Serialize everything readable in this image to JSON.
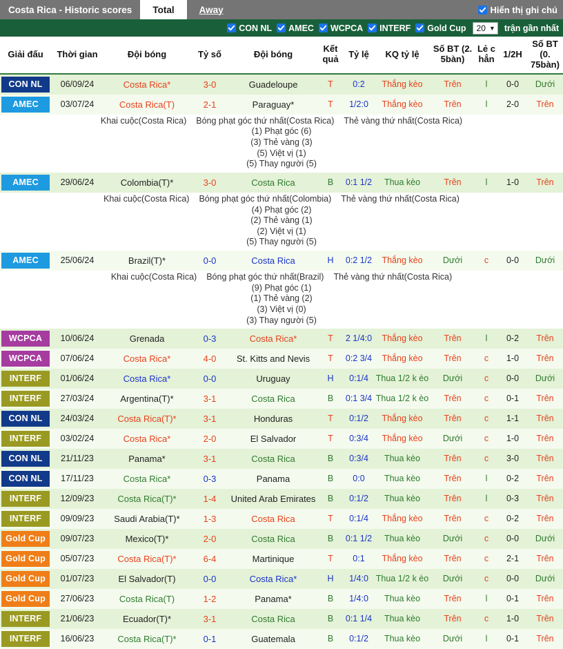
{
  "header": {
    "title": "Costa Rica - Historic scores",
    "tabs": [
      {
        "label": "Total",
        "active": true
      },
      {
        "label": "Away",
        "active": false
      }
    ],
    "show_notes_label": "Hiển thị ghi chú",
    "show_notes_checked": true
  },
  "filters": {
    "leagues": [
      {
        "label": "CON NL",
        "checked": true
      },
      {
        "label": "AMEC",
        "checked": true
      },
      {
        "label": "WCPCA",
        "checked": true
      },
      {
        "label": "INTERF",
        "checked": true
      },
      {
        "label": "Gold Cup",
        "checked": true
      }
    ],
    "count_value": "20",
    "count_suffix": "trận gần nhất"
  },
  "columns": [
    "Giải đấu",
    "Thời gian",
    "Đội bóng",
    "Tỷ số",
    "Đội bóng",
    "Kết quả",
    "Tỷ lệ",
    "KQ tỷ lệ",
    "Số BT (2. 5bàn)",
    "Lẻ c hẳn",
    "1/2H",
    "Số BT (0. 75bàn)"
  ],
  "league_colors": {
    "CON NL": "#123a8a",
    "AMEC": "#1e9ae0",
    "WCPCA": "#a63ba0",
    "INTERF": "#9a9a22",
    "Gold Cup": "#f07e18"
  },
  "rows": [
    {
      "league": "CON NL",
      "date": "06/09/24",
      "home": "Costa Rica*",
      "home_color": "red",
      "score": "3-0",
      "score_color": "red",
      "away": "Guadeloupe",
      "away_color": "dark",
      "result": "T",
      "result_color": "red",
      "odds": "0:2",
      "odds_color": "blue",
      "odds_result": "Thắng kèo",
      "odds_result_color": "red",
      "ou25": "Trên",
      "ou25_color": "red",
      "oddeven": "l",
      "oddeven_color": "green",
      "half": "0-0",
      "half_color": "dark",
      "ou075": "Dưới",
      "ou075_color": "green"
    },
    {
      "league": "AMEC",
      "date": "03/07/24",
      "home": "Costa Rica(T)",
      "home_color": "red",
      "score": "2-1",
      "score_color": "red",
      "away": "Paraguay*",
      "away_color": "dark",
      "result": "T",
      "result_color": "red",
      "odds": "1/2:0",
      "odds_color": "blue",
      "odds_result": "Thắng kèo",
      "odds_result_color": "red",
      "ou25": "Trên",
      "ou25_color": "red",
      "oddeven": "l",
      "oddeven_color": "green",
      "half": "2-0",
      "half_color": "dark",
      "ou075": "Trên",
      "ou075_color": "red",
      "note": {
        "head": [
          "Khai cuộc(Costa Rica)",
          "Bóng phạt góc thứ nhất(Costa Rica)",
          "Thẻ vàng thứ nhất(Costa Rica)"
        ],
        "lines": [
          "(1) Phạt góc (6)",
          "(3) Thẻ vàng (3)",
          "(5) Việt vị (1)",
          "(5) Thay người (5)"
        ]
      }
    },
    {
      "league": "AMEC",
      "date": "29/06/24",
      "home": "Colombia(T)*",
      "home_color": "dark",
      "score": "3-0",
      "score_color": "red",
      "away": "Costa Rica",
      "away_color": "green",
      "result": "B",
      "result_color": "green",
      "odds": "0:1 1/2",
      "odds_color": "blue",
      "odds_result": "Thua kèo",
      "odds_result_color": "green",
      "ou25": "Trên",
      "ou25_color": "red",
      "oddeven": "l",
      "oddeven_color": "green",
      "half": "1-0",
      "half_color": "dark",
      "ou075": "Trên",
      "ou075_color": "red",
      "note": {
        "head": [
          "Khai cuộc(Costa Rica)",
          "Bóng phạt góc thứ nhất(Colombia)",
          "Thẻ vàng thứ nhất(Costa Rica)"
        ],
        "lines": [
          "(4) Phạt góc (2)",
          "(2) Thẻ vàng (1)",
          "(2) Việt vị (1)",
          "(5) Thay người (5)"
        ]
      }
    },
    {
      "league": "AMEC",
      "date": "25/06/24",
      "home": "Brazil(T)*",
      "home_color": "dark",
      "score": "0-0",
      "score_color": "blue",
      "away": "Costa Rica",
      "away_color": "blue",
      "result": "H",
      "result_color": "blue",
      "odds": "0:2 1/2",
      "odds_color": "blue",
      "odds_result": "Thắng kèo",
      "odds_result_color": "red",
      "ou25": "Dưới",
      "ou25_color": "green",
      "oddeven": "c",
      "oddeven_color": "red",
      "half": "0-0",
      "half_color": "dark",
      "ou075": "Dưới",
      "ou075_color": "green",
      "note": {
        "head": [
          "Khai cuộc(Costa Rica)",
          "Bóng phạt góc thứ nhất(Brazil)",
          "Thẻ vàng thứ nhất(Costa Rica)"
        ],
        "lines": [
          "(9) Phạt góc (1)",
          "(1) Thẻ vàng (2)",
          "(3) Việt vị (0)",
          "(3) Thay người (5)"
        ]
      }
    },
    {
      "league": "WCPCA",
      "date": "10/06/24",
      "home": "Grenada",
      "home_color": "dark",
      "score": "0-3",
      "score_color": "blue",
      "away": "Costa Rica*",
      "away_color": "red",
      "result": "T",
      "result_color": "red",
      "odds": "2 1/4:0",
      "odds_color": "blue",
      "odds_result": "Thắng kèo",
      "odds_result_color": "red",
      "ou25": "Trên",
      "ou25_color": "red",
      "oddeven": "l",
      "oddeven_color": "green",
      "half": "0-2",
      "half_color": "dark",
      "ou075": "Trên",
      "ou075_color": "red"
    },
    {
      "league": "WCPCA",
      "date": "07/06/24",
      "home": "Costa Rica*",
      "home_color": "red",
      "score": "4-0",
      "score_color": "red",
      "away": "St. Kitts and Nevis",
      "away_color": "dark",
      "result": "T",
      "result_color": "red",
      "odds": "0:2 3/4",
      "odds_color": "blue",
      "odds_result": "Thắng kèo",
      "odds_result_color": "red",
      "ou25": "Trên",
      "ou25_color": "red",
      "oddeven": "c",
      "oddeven_color": "red",
      "half": "1-0",
      "half_color": "dark",
      "ou075": "Trên",
      "ou075_color": "red"
    },
    {
      "league": "INTERF",
      "date": "01/06/24",
      "home": "Costa Rica*",
      "home_color": "blue",
      "score": "0-0",
      "score_color": "blue",
      "away": "Uruguay",
      "away_color": "dark",
      "result": "H",
      "result_color": "blue",
      "odds": "0:1/4",
      "odds_color": "blue",
      "odds_result": "Thua 1/2 k èo",
      "odds_result_color": "green",
      "ou25": "Dưới",
      "ou25_color": "green",
      "oddeven": "c",
      "oddeven_color": "red",
      "half": "0-0",
      "half_color": "dark",
      "ou075": "Dưới",
      "ou075_color": "green"
    },
    {
      "league": "INTERF",
      "date": "27/03/24",
      "home": "Argentina(T)*",
      "home_color": "dark",
      "score": "3-1",
      "score_color": "red",
      "away": "Costa Rica",
      "away_color": "green",
      "result": "B",
      "result_color": "green",
      "odds": "0:1 3/4",
      "odds_color": "blue",
      "odds_result": "Thua 1/2 k èo",
      "odds_result_color": "green",
      "ou25": "Trên",
      "ou25_color": "red",
      "oddeven": "c",
      "oddeven_color": "red",
      "half": "0-1",
      "half_color": "dark",
      "ou075": "Trên",
      "ou075_color": "red"
    },
    {
      "league": "CON NL",
      "date": "24/03/24",
      "home": "Costa Rica(T)*",
      "home_color": "red",
      "score": "3-1",
      "score_color": "red",
      "away": "Honduras",
      "away_color": "dark",
      "result": "T",
      "result_color": "red",
      "odds": "0:1/2",
      "odds_color": "blue",
      "odds_result": "Thắng kèo",
      "odds_result_color": "red",
      "ou25": "Trên",
      "ou25_color": "red",
      "oddeven": "c",
      "oddeven_color": "red",
      "half": "1-1",
      "half_color": "dark",
      "ou075": "Trên",
      "ou075_color": "red"
    },
    {
      "league": "INTERF",
      "date": "03/02/24",
      "home": "Costa Rica*",
      "home_color": "red",
      "score": "2-0",
      "score_color": "red",
      "away": "El Salvador",
      "away_color": "dark",
      "result": "T",
      "result_color": "red",
      "odds": "0:3/4",
      "odds_color": "blue",
      "odds_result": "Thắng kèo",
      "odds_result_color": "red",
      "ou25": "Dưới",
      "ou25_color": "green",
      "oddeven": "c",
      "oddeven_color": "red",
      "half": "1-0",
      "half_color": "dark",
      "ou075": "Trên",
      "ou075_color": "red"
    },
    {
      "league": "CON NL",
      "date": "21/11/23",
      "home": "Panama*",
      "home_color": "dark",
      "score": "3-1",
      "score_color": "red",
      "away": "Costa Rica",
      "away_color": "green",
      "result": "B",
      "result_color": "green",
      "odds": "0:3/4",
      "odds_color": "blue",
      "odds_result": "Thua kèo",
      "odds_result_color": "green",
      "ou25": "Trên",
      "ou25_color": "red",
      "oddeven": "c",
      "oddeven_color": "red",
      "half": "3-0",
      "half_color": "dark",
      "ou075": "Trên",
      "ou075_color": "red"
    },
    {
      "league": "CON NL",
      "date": "17/11/23",
      "home": "Costa Rica*",
      "home_color": "green",
      "score": "0-3",
      "score_color": "blue",
      "away": "Panama",
      "away_color": "dark",
      "result": "B",
      "result_color": "green",
      "odds": "0:0",
      "odds_color": "blue",
      "odds_result": "Thua kèo",
      "odds_result_color": "green",
      "ou25": "Trên",
      "ou25_color": "red",
      "oddeven": "l",
      "oddeven_color": "green",
      "half": "0-2",
      "half_color": "dark",
      "ou075": "Trên",
      "ou075_color": "red"
    },
    {
      "league": "INTERF",
      "date": "12/09/23",
      "home": "Costa Rica(T)*",
      "home_color": "green",
      "score": "1-4",
      "score_color": "red",
      "away": "United Arab Emirates",
      "away_color": "dark",
      "result": "B",
      "result_color": "green",
      "odds": "0:1/2",
      "odds_color": "blue",
      "odds_result": "Thua kèo",
      "odds_result_color": "green",
      "ou25": "Trên",
      "ou25_color": "red",
      "oddeven": "l",
      "oddeven_color": "green",
      "half": "0-3",
      "half_color": "dark",
      "ou075": "Trên",
      "ou075_color": "red"
    },
    {
      "league": "INTERF",
      "date": "09/09/23",
      "home": "Saudi Arabia(T)*",
      "home_color": "dark",
      "score": "1-3",
      "score_color": "red",
      "away": "Costa Rica",
      "away_color": "red",
      "result": "T",
      "result_color": "red",
      "odds": "0:1/4",
      "odds_color": "blue",
      "odds_result": "Thắng kèo",
      "odds_result_color": "red",
      "ou25": "Trên",
      "ou25_color": "red",
      "oddeven": "c",
      "oddeven_color": "red",
      "half": "0-2",
      "half_color": "dark",
      "ou075": "Trên",
      "ou075_color": "red"
    },
    {
      "league": "Gold Cup",
      "date": "09/07/23",
      "home": "Mexico(T)*",
      "home_color": "dark",
      "score": "2-0",
      "score_color": "red",
      "away": "Costa Rica",
      "away_color": "green",
      "result": "B",
      "result_color": "green",
      "odds": "0:1 1/2",
      "odds_color": "blue",
      "odds_result": "Thua kèo",
      "odds_result_color": "green",
      "ou25": "Dưới",
      "ou25_color": "green",
      "oddeven": "c",
      "oddeven_color": "red",
      "half": "0-0",
      "half_color": "dark",
      "ou075": "Dưới",
      "ou075_color": "green"
    },
    {
      "league": "Gold Cup",
      "date": "05/07/23",
      "home": "Costa Rica(T)*",
      "home_color": "red",
      "score": "6-4",
      "score_color": "red",
      "away": "Martinique",
      "away_color": "dark",
      "result": "T",
      "result_color": "red",
      "odds": "0:1",
      "odds_color": "blue",
      "odds_result": "Thắng kèo",
      "odds_result_color": "red",
      "ou25": "Trên",
      "ou25_color": "red",
      "oddeven": "c",
      "oddeven_color": "red",
      "half": "2-1",
      "half_color": "dark",
      "ou075": "Trên",
      "ou075_color": "red"
    },
    {
      "league": "Gold Cup",
      "date": "01/07/23",
      "home": "El Salvador(T)",
      "home_color": "dark",
      "score": "0-0",
      "score_color": "blue",
      "away": "Costa Rica*",
      "away_color": "blue",
      "result": "H",
      "result_color": "blue",
      "odds": "1/4:0",
      "odds_color": "blue",
      "odds_result": "Thua 1/2 k èo",
      "odds_result_color": "green",
      "ou25": "Dưới",
      "ou25_color": "green",
      "oddeven": "c",
      "oddeven_color": "red",
      "half": "0-0",
      "half_color": "dark",
      "ou075": "Dưới",
      "ou075_color": "green"
    },
    {
      "league": "Gold Cup",
      "date": "27/06/23",
      "home": "Costa Rica(T)",
      "home_color": "green",
      "score": "1-2",
      "score_color": "red",
      "away": "Panama*",
      "away_color": "dark",
      "result": "B",
      "result_color": "green",
      "odds": "1/4:0",
      "odds_color": "blue",
      "odds_result": "Thua kèo",
      "odds_result_color": "green",
      "ou25": "Trên",
      "ou25_color": "red",
      "oddeven": "l",
      "oddeven_color": "green",
      "half": "0-1",
      "half_color": "dark",
      "ou075": "Trên",
      "ou075_color": "red"
    },
    {
      "league": "INTERF",
      "date": "21/06/23",
      "home": "Ecuador(T)*",
      "home_color": "dark",
      "score": "3-1",
      "score_color": "red",
      "away": "Costa Rica",
      "away_color": "green",
      "result": "B",
      "result_color": "green",
      "odds": "0:1 1/4",
      "odds_color": "blue",
      "odds_result": "Thua kèo",
      "odds_result_color": "green",
      "ou25": "Trên",
      "ou25_color": "red",
      "oddeven": "c",
      "oddeven_color": "red",
      "half": "1-0",
      "half_color": "dark",
      "ou075": "Trên",
      "ou075_color": "red"
    },
    {
      "league": "INTERF",
      "date": "16/06/23",
      "home": "Costa Rica(T)*",
      "home_color": "green",
      "score": "0-1",
      "score_color": "blue",
      "away": "Guatemala",
      "away_color": "dark",
      "result": "B",
      "result_color": "green",
      "odds": "0:1/2",
      "odds_color": "blue",
      "odds_result": "Thua kèo",
      "odds_result_color": "green",
      "ou25": "Dưới",
      "ou25_color": "green",
      "oddeven": "l",
      "oddeven_color": "green",
      "half": "0-1",
      "half_color": "dark",
      "ou075": "Trên",
      "ou075_color": "red"
    }
  ]
}
